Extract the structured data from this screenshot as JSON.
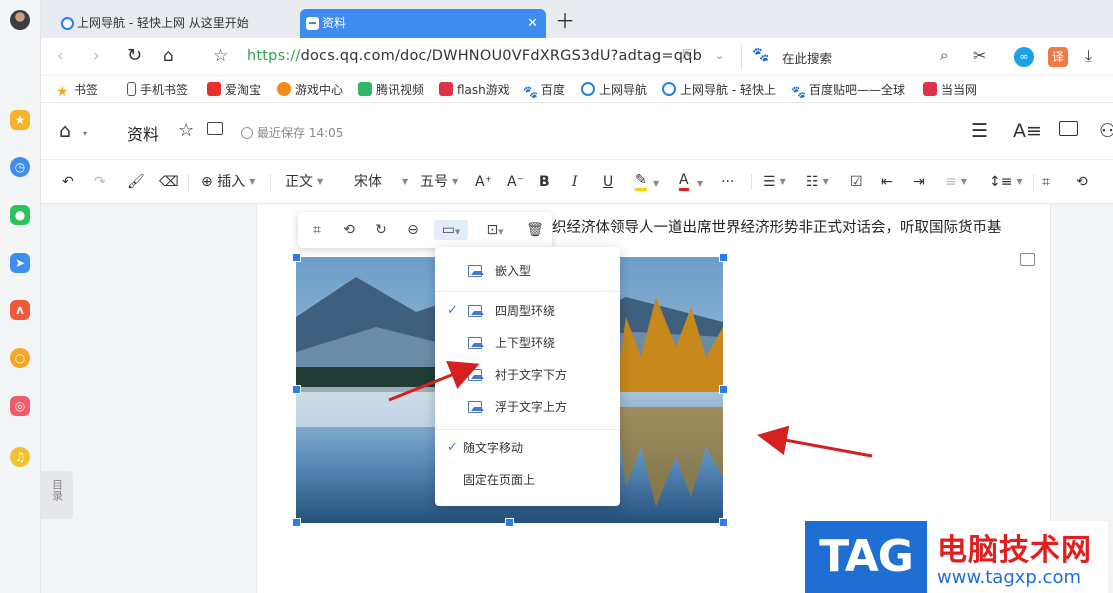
{
  "tabs": [
    {
      "label": "上网导航 - 轻快上网 从这里开始",
      "active": false
    },
    {
      "label": "资料",
      "active": true
    }
  ],
  "address_bar": {
    "protocol": "https://",
    "url": "docs.qq.com/doc/DWHNOU0VFdXRGS3dU?adtag=qqb",
    "search_placeholder": "在此搜索"
  },
  "bookmarks": [
    {
      "label": "书签",
      "icon": "star-icon"
    },
    {
      "label": "手机书签",
      "icon": "phone-icon"
    },
    {
      "label": "爱淘宝",
      "icon": "taobao-icon"
    },
    {
      "label": "游戏中心",
      "icon": "game-icon"
    },
    {
      "label": "腾讯视频",
      "icon": "video-icon"
    },
    {
      "label": "flash游戏",
      "icon": "flash-icon"
    },
    {
      "label": "百度",
      "icon": "baidu-icon"
    },
    {
      "label": "上网导航",
      "icon": "ie-icon"
    },
    {
      "label": "上网导航 - 轻快上",
      "icon": "ie-icon"
    },
    {
      "label": "百度贴吧——全球",
      "icon": "baidu-icon"
    },
    {
      "label": "当当网",
      "icon": "dangdang-icon"
    }
  ],
  "doc": {
    "title": "资料",
    "save_status": "最近保存 14:05",
    "body_text": "织经济体领导人一道出席世界经济形势非正式对话会，听取国际货币基",
    "toc_label": "目录"
  },
  "toolbar": {
    "insert": "插入",
    "style": "正文",
    "font": "宋体",
    "size": "五号",
    "more": "···"
  },
  "wrap_menu": {
    "items": [
      {
        "label": "嵌入型",
        "checked": false
      },
      {
        "label": "四周型环绕",
        "checked": true
      },
      {
        "label": "上下型环绕",
        "checked": false
      },
      {
        "label": "衬于文字下方",
        "checked": false
      },
      {
        "label": "浮于文字上方",
        "checked": false
      }
    ],
    "position_items": [
      {
        "label": "随文字移动",
        "checked": true
      },
      {
        "label": "固定在页面上",
        "checked": false
      }
    ]
  },
  "watermark": {
    "logo": "TAG",
    "title": "电脑技术网",
    "url": "www.tagxp.com"
  },
  "colors": {
    "accent": "#2b7de9",
    "active_tab": "#3f8cf0",
    "url_protocol": "#2da44e",
    "arrow": "#d42020"
  }
}
